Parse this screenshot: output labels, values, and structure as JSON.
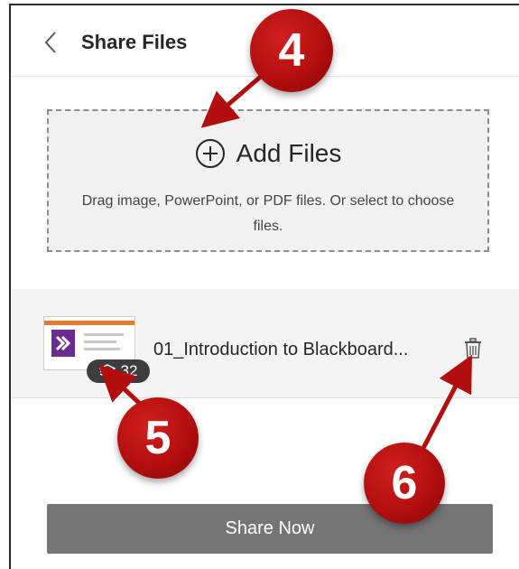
{
  "header": {
    "title": "Share Files",
    "back_icon": "chevron-left-icon"
  },
  "dropzone": {
    "add_label": "Add Files",
    "add_icon": "plus-circle-icon",
    "hint": "Drag image, PowerPoint, or PDF files. Or select to choose files."
  },
  "file": {
    "name": "01_Introduction to Blackboard...",
    "slide_count": "32",
    "badge_icon": "layers-icon",
    "delete_icon": "trash-icon"
  },
  "footer": {
    "share_label": "Share Now"
  },
  "callouts": {
    "c4": "4",
    "c5": "5",
    "c6": "6"
  },
  "colors": {
    "callout_red": "#b20e0e",
    "share_button": "#757575"
  }
}
